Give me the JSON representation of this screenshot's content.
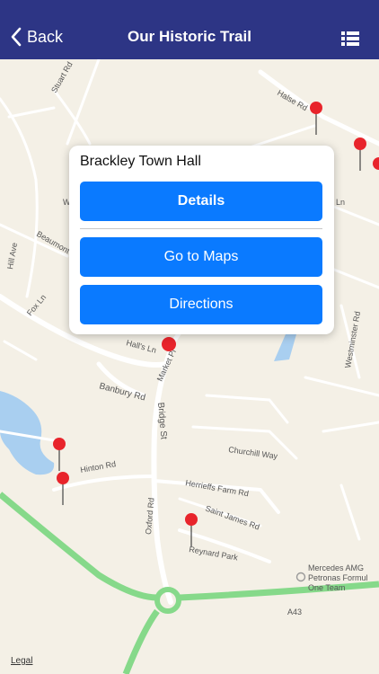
{
  "navbar": {
    "back_label": "Back",
    "title": "Our Historic Trail",
    "icons": {
      "back": "chevron-left-icon",
      "list": "list-icon"
    },
    "background_color": "#2d3585"
  },
  "popup": {
    "place_name": "Brackley Town Hall",
    "buttons": {
      "details": "Details",
      "go_to_maps": "Go to Maps",
      "directions": "Directions"
    },
    "button_color": "#0a7aff"
  },
  "map": {
    "streets": {
      "stuart_rd": "Stuart Rd",
      "halse_rd": "Halse Rd",
      "beaumont": "Beaumont",
      "hill_ave": "Hill Ave",
      "fox_ln": "Fox Ln",
      "ln": "Ln",
      "westminster_rd": "Westminster Rd",
      "halls_ln": "Hall's Ln",
      "market_pl": "Market Pl",
      "banbury_rd": "Banbury Rd",
      "bridge_st": "Bridge St",
      "churchill_way": "Churchill Way",
      "hinton_rd": "Hinton Rd",
      "herrieffs_farm_rd": "Herrieffs Farm Rd",
      "saint_james_rd": "Saint James Rd",
      "oxford_rd": "Oxford Rd",
      "reynard_park": "Reynard Park",
      "a43": "A43",
      "w": "W"
    },
    "poi": {
      "line1": "Mercedes AMG",
      "line2": "Petronas Formul",
      "line3": "One Team"
    },
    "legal": "Legal",
    "colors": {
      "land": "#f4f0e6",
      "road": "#ffffff",
      "water": "#a9cff0",
      "highway": "#86d98a",
      "pin": "#e8242b"
    }
  }
}
